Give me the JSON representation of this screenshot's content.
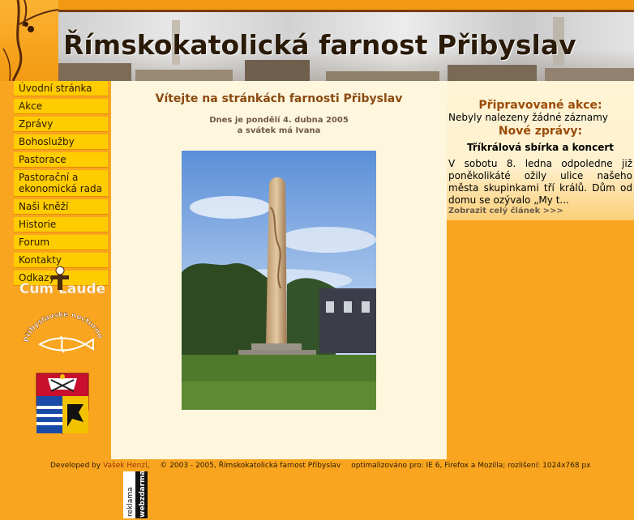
{
  "header": {
    "title": "Římskokatolická farnost Přibyslav"
  },
  "nav": {
    "items": [
      {
        "label": "Úvodní stránka"
      },
      {
        "label": "Akce"
      },
      {
        "label": "Zprávy"
      },
      {
        "label": "Bohoslužby"
      },
      {
        "label": "Pastorace"
      },
      {
        "label": "Pastorační a ekonomická rada"
      },
      {
        "label": "Naši kněží"
      },
      {
        "label": "Historie"
      },
      {
        "label": "Forum"
      },
      {
        "label": "Kontakty"
      },
      {
        "label": "Odkazy"
      }
    ]
  },
  "logos": {
    "cum_laude": "Cum Laude",
    "nocturno": "Přibyslavské nocturno"
  },
  "main": {
    "welcome": "Vítejte na stránkách farnosti Přibyslav",
    "date_line": "Dnes je pondělí 4. dubna 2005",
    "name_day_line": "a svátek má Ivana"
  },
  "sidebar": {
    "events_title": "Připravované akce:",
    "events_empty": "Nebyly nalezeny žádné záznamy",
    "news_title": "Nové zprávy:",
    "news_heading": "Tříkrálová sbírka a koncert",
    "news_text": "V sobotu 8. ledna odpoledne již poněkolikáté ožily ulice našeho města skupinkami tří králů. Dům od domu se ozývalo „My t...",
    "news_more": "Zobrazit celý článek >>>"
  },
  "footer": {
    "developed_by": "Developed by",
    "author": "Vašek Henzl",
    "copyright": "© 2003 - 2005, Římskokatolická farnost Přibyslav",
    "optimized": "optimalizováno pro: IE 6, Firefox a Mozilla; rozlišení: 1024x768 px"
  },
  "banner": {
    "line1": "reklama",
    "line2": "webzdarma"
  },
  "colors": {
    "page_bg": "#f9a51f",
    "nav_item_bg": "#ffcc00",
    "content_bg": "#fff6de",
    "heading": "#9a4c08"
  }
}
